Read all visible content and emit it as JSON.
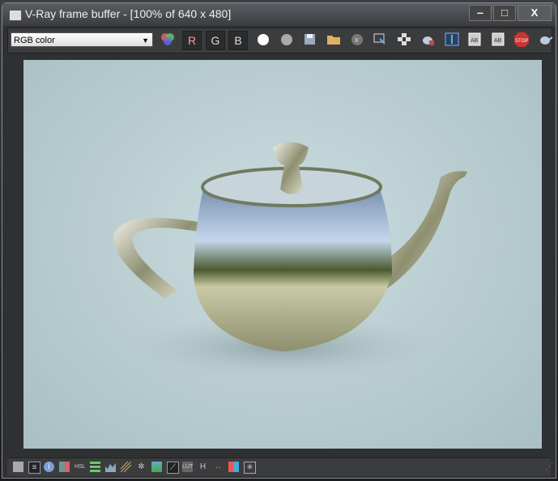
{
  "window": {
    "title": "V-Ray frame buffer - [100% of 640 x 480]",
    "minimize": "‒",
    "maximize": "□",
    "close": "X"
  },
  "toolbar": {
    "channel_select": "RGB color",
    "red_label": "R",
    "green_label": "G",
    "blue_label": "B",
    "icons": [
      "color-wheel-icon",
      "red-channel",
      "green-channel",
      "blue-channel",
      "white-circle-icon",
      "gray-circle-icon",
      "save-icon",
      "open-folder-icon",
      "clear-icon",
      "region-render-icon",
      "track-mouse-icon",
      "teapot-render-icon",
      "ab-compare-icon",
      "ab-horizontal-icon",
      "ab-vertical-icon",
      "stop-icon",
      "render-teapot-icon"
    ],
    "stop_label": "STOP"
  },
  "render": {
    "content": "chrome teapot render"
  },
  "bottom": {
    "h_label": "H",
    "lut_label": "LUT",
    "hsl_label": "HSL"
  }
}
